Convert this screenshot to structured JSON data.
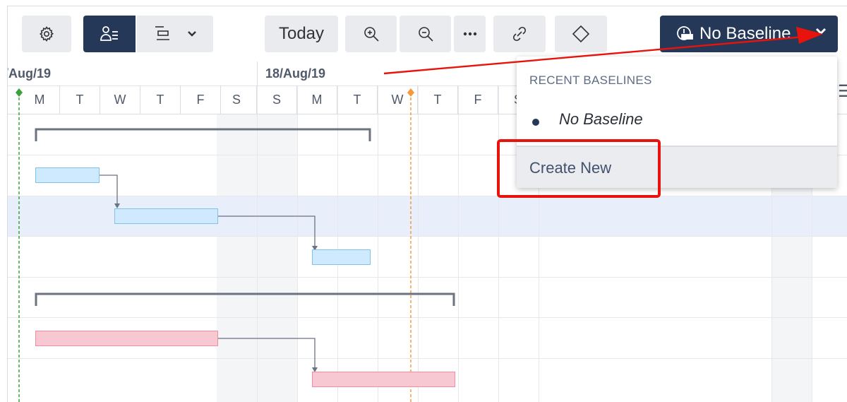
{
  "toolbar": {
    "settings_icon": "gear-icon",
    "view_toggle": [
      "person-list-icon",
      "gantt-icon"
    ],
    "today_label": "Today",
    "zoom_in_icon": "zoom-in-icon",
    "zoom_out_icon": "zoom-out-icon",
    "more_icon": "ellipsis-icon",
    "link_icon": "link-icon",
    "milestone_icon": "diamond-icon",
    "baseline_label": "No Baseline"
  },
  "timeline": {
    "weeks": [
      "/Aug/19",
      "18/Aug/19"
    ],
    "days": [
      "M",
      "T",
      "W",
      "T",
      "F",
      "S",
      "S",
      "M",
      "T",
      "W",
      "T",
      "F",
      "S"
    ]
  },
  "baseline_menu": {
    "header": "RECENT BASELINES",
    "current": "No Baseline",
    "create_label": "Create New"
  },
  "colors": {
    "accent": "#253858",
    "today_line": "#f59a3b",
    "start_line": "#3aa23a",
    "annotation": "#e8130c",
    "task_blue": "#cfeaff",
    "task_pink": "#f8c8d2"
  }
}
